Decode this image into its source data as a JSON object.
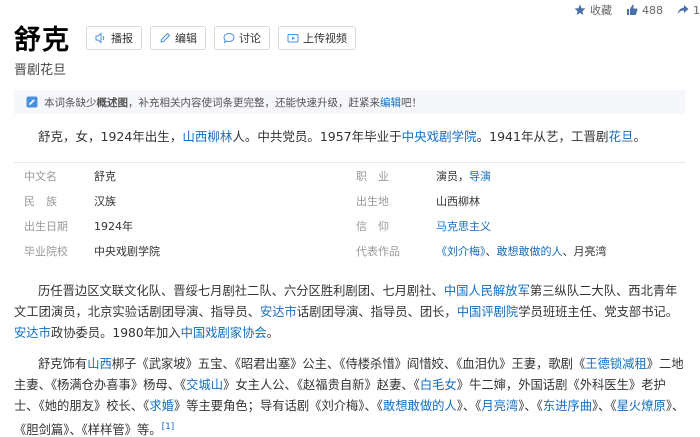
{
  "topbar": {
    "favorite_label": "收藏",
    "like_count": "488",
    "share_count": "1"
  },
  "title": "舒克",
  "toolbar": {
    "broadcast": "播报",
    "edit": "编辑",
    "discuss": "讨论",
    "upload_video": "上传视频"
  },
  "subtitle": "晋剧花旦",
  "notice": {
    "text": "本词条缺少",
    "bold": "概述图",
    "text2": "，补充相关内容使词条更完整，还能快速升级，赶紧来",
    "link": "编辑",
    "text3": "吧！"
  },
  "summary": {
    "t1": "舒克，女，1924年出生，",
    "l1": "山西柳林",
    "t2": "人。中共党员。1957年毕业于",
    "l2": "中央戏剧学院",
    "t3": "。1941年从艺，工晋剧",
    "l3": "花旦",
    "t4": "。"
  },
  "info": {
    "chinese_name": {
      "key": "中文名",
      "value": "舒克"
    },
    "nation": {
      "key": "民　族",
      "value": "汉族"
    },
    "birth_date": {
      "key": "出生日期",
      "value": "1924年"
    },
    "school": {
      "key": "毕业院校",
      "value": "中央戏剧学院"
    },
    "job": {
      "key": "职　业",
      "value": "演员，",
      "link": "导演"
    },
    "birthplace": {
      "key": "出生地",
      "value": "山西柳林"
    },
    "belief": {
      "key": "信　仰",
      "link": "马克思主义"
    },
    "works": {
      "key": "代表作品",
      "link1": "《刘介梅》",
      "sep1": "、",
      "link2": "敢想敢做的人",
      "sep2": "、月亮湾"
    }
  },
  "para1": {
    "t1": "历任晋边区文联文化队、晋绥七月剧社二队、六分区胜利剧团、七月剧社、",
    "l1": "中国人民解放军",
    "t2": "第三纵队二大队、西北青年文工团演员，北京实验话剧团导演、指导员、",
    "l2": "安达市",
    "t3": "话剧团导演、指导员、团长，",
    "l3": "中国评剧院",
    "t4": "学员班班主任、党支部书记。",
    "l4": "安达市",
    "t5": "政协委员。1980年加入",
    "l5": "中国戏剧家协会",
    "t6": "。"
  },
  "para2": {
    "t1": "舒克饰有",
    "l1": "山西",
    "t2": "梆子《武家坡》五宝、《昭君出塞》公主、《侍楼杀惜》阎惜姣、《血泪仇》王妻，歌剧《",
    "l2": "王德锁减租",
    "t3": "》二地主妻、《杨满仓办喜事》杨母、《",
    "l3": "交城山",
    "t4": "》女主人公、《赵福贵自新》赵妻、《",
    "l4": "白毛女",
    "t5": "》牛二婶，外国话剧《外科医生》老护士、《她的朋友》校长、《",
    "l5": "求婚",
    "t6": "》等主要角色；导有话剧《刘介梅》、《",
    "l6": "敢想敢做的人",
    "t7": "》、《",
    "l7": "月亮湾",
    "t8": "》、《",
    "l8": "东进序曲",
    "t9": "》、《",
    "l9": "星火燎原",
    "t10": "》、《胆剑篇》、《样样管》等。",
    "ref": "[1]"
  },
  "colors": {
    "link": "#136ec2",
    "accent_blue": "#4a90e2"
  },
  "icons": {
    "favorite": "star-icon",
    "like": "thumb-up-icon",
    "share": "share-icon",
    "broadcast": "speaker-icon",
    "edit": "pencil-icon",
    "discuss": "chat-bubble-icon",
    "upload": "video-upload-icon",
    "notice": "edit-note-icon"
  }
}
